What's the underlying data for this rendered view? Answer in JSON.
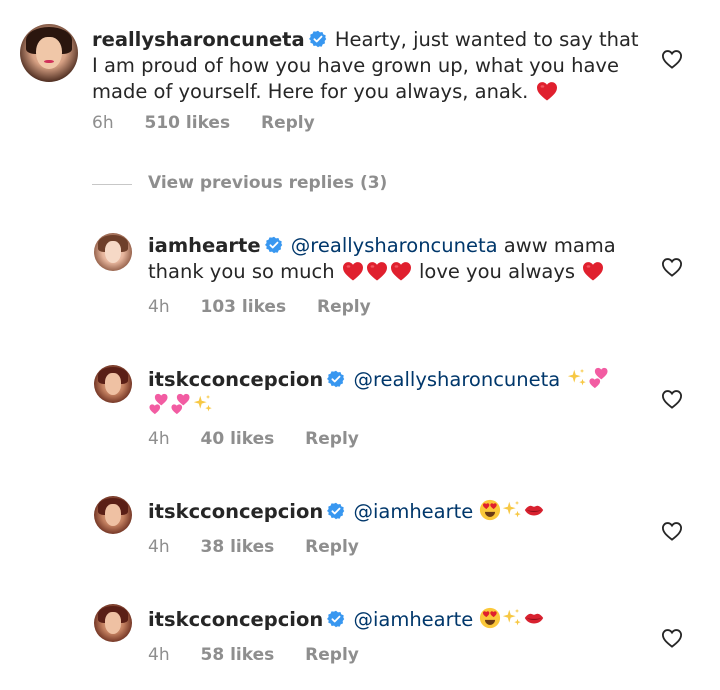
{
  "comments": [
    {
      "username": "reallysharoncuneta",
      "line1": "Hearty, just wanted to say that",
      "line2": "I am proud of how you have grown up, what you have",
      "line3": "made of yourself. Here for you always, anak.",
      "time": "6h",
      "likes": "510 likes",
      "reply": "Reply"
    },
    {
      "username": "iamhearte",
      "mention": "@reallysharoncuneta",
      "after_mention": " aww mama",
      "line2_start": "thank you so much",
      "line2_middle": "love you always",
      "time": "4h",
      "likes": "103 likes",
      "reply": "Reply"
    },
    {
      "username": "itskcconcepcion",
      "mention": "@reallysharoncuneta",
      "time": "4h",
      "likes": "40 likes",
      "reply": "Reply"
    },
    {
      "username": "itskcconcepcion",
      "mention": "@iamhearte",
      "time": "4h",
      "likes": "38 likes",
      "reply": "Reply"
    },
    {
      "username": "itskcconcepcion",
      "mention": "@iamhearte",
      "time": "4h",
      "likes": "58 likes",
      "reply": "Reply"
    }
  ],
  "view_previous": "View previous replies (3)",
  "colors": {
    "text": "#262626",
    "meta": "#8e8e8e",
    "mention": "#00376b",
    "verified": "#3897f0",
    "heart": "#e0245e"
  }
}
